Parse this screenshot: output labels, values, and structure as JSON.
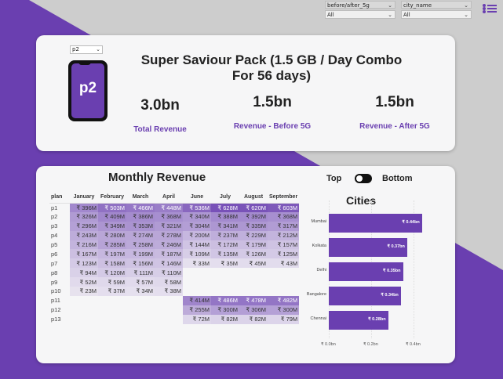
{
  "filters": [
    {
      "label": "before/after_5g",
      "value": "All"
    },
    {
      "label": "city_name",
      "value": "All"
    }
  ],
  "plan_selector": {
    "value": "p2"
  },
  "phone_label": "p2",
  "pack_title": "Super Saviour Pack (1.5 GB / Day Combo For 56 days)",
  "kpis": [
    {
      "value": "3.0bn",
      "label": "Total Revenue"
    },
    {
      "value": "1.5bn",
      "label": "Revenue - Before 5G"
    },
    {
      "value": "1.5bn",
      "label": "Revenue - After 5G"
    }
  ],
  "monthly_revenue": {
    "title": "Monthly Revenue",
    "columns": [
      "plan",
      "January",
      "February",
      "March",
      "April",
      "June",
      "July",
      "August",
      "September"
    ],
    "rows": [
      {
        "plan": "p1",
        "cells": [
          "₹ 396M",
          "₹ 503M",
          "₹ 466M",
          "₹ 448M",
          "₹ 536M",
          "₹ 628M",
          "₹ 620M",
          "₹ 603M"
        ]
      },
      {
        "plan": "p2",
        "cells": [
          "₹ 326M",
          "₹ 409M",
          "₹ 386M",
          "₹ 368M",
          "₹ 340M",
          "₹ 388M",
          "₹ 392M",
          "₹ 368M"
        ]
      },
      {
        "plan": "p3",
        "cells": [
          "₹ 296M",
          "₹ 349M",
          "₹ 353M",
          "₹ 321M",
          "₹ 304M",
          "₹ 341M",
          "₹ 335M",
          "₹ 317M"
        ]
      },
      {
        "plan": "p4",
        "cells": [
          "₹ 243M",
          "₹ 280M",
          "₹ 274M",
          "₹ 278M",
          "₹ 200M",
          "₹ 237M",
          "₹ 229M",
          "₹ 212M"
        ]
      },
      {
        "plan": "p5",
        "cells": [
          "₹ 216M",
          "₹ 285M",
          "₹ 258M",
          "₹ 246M",
          "₹ 144M",
          "₹ 172M",
          "₹ 179M",
          "₹ 157M"
        ]
      },
      {
        "plan": "p6",
        "cells": [
          "₹ 167M",
          "₹ 197M",
          "₹ 199M",
          "₹ 187M",
          "₹ 109M",
          "₹ 135M",
          "₹ 126M",
          "₹ 125M"
        ]
      },
      {
        "plan": "p7",
        "cells": [
          "₹ 123M",
          "₹ 158M",
          "₹ 156M",
          "₹ 146M",
          "₹ 33M",
          "₹ 35M",
          "₹ 45M",
          "₹ 43M"
        ]
      },
      {
        "plan": "p8",
        "cells": [
          "₹ 94M",
          "₹ 120M",
          "₹ 111M",
          "₹ 110M",
          "",
          "",
          "",
          ""
        ]
      },
      {
        "plan": "p9",
        "cells": [
          "₹ 52M",
          "₹ 59M",
          "₹ 57M",
          "₹ 58M",
          "",
          "",
          "",
          ""
        ]
      },
      {
        "plan": "p10",
        "cells": [
          "₹ 23M",
          "₹ 37M",
          "₹ 34M",
          "₹ 38M",
          "",
          "",
          "",
          ""
        ]
      },
      {
        "plan": "p11",
        "cells": [
          "",
          "",
          "",
          "",
          "₹ 414M",
          "₹ 486M",
          "₹ 478M",
          "₹ 482M"
        ]
      },
      {
        "plan": "p12",
        "cells": [
          "",
          "",
          "",
          "",
          "₹ 255M",
          "₹ 300M",
          "₹ 306M",
          "₹ 300M"
        ]
      },
      {
        "plan": "p13",
        "cells": [
          "",
          "",
          "",
          "",
          "₹ 72M",
          "₹ 82M",
          "₹ 82M",
          "₹ 79M"
        ]
      }
    ]
  },
  "toggle": {
    "left_label": "Top",
    "right_label": "Bottom"
  },
  "cities": {
    "title": "Cities",
    "axis_ticks": [
      "₹ 0.0bn",
      "₹ 0.2bn",
      "₹ 0.4bn"
    ],
    "bar_color": "#6a3fb0",
    "items": [
      {
        "city": "Mumbai",
        "label": "₹ 0.44bn",
        "value": 0.44
      },
      {
        "city": "Kolkata",
        "label": "₹ 0.37bn",
        "value": 0.37
      },
      {
        "city": "Delhi",
        "label": "₹ 0.35bn",
        "value": 0.35
      },
      {
        "city": "Bangalore",
        "label": "₹ 0.34bn",
        "value": 0.34
      },
      {
        "city": "Chennai",
        "label": "₹ 0.28bn",
        "value": 0.28
      }
    ]
  },
  "colors": {
    "accent": "#6a3fb0",
    "background_purple": "#6a3fb0",
    "background_gray": "#cdcdcd"
  }
}
